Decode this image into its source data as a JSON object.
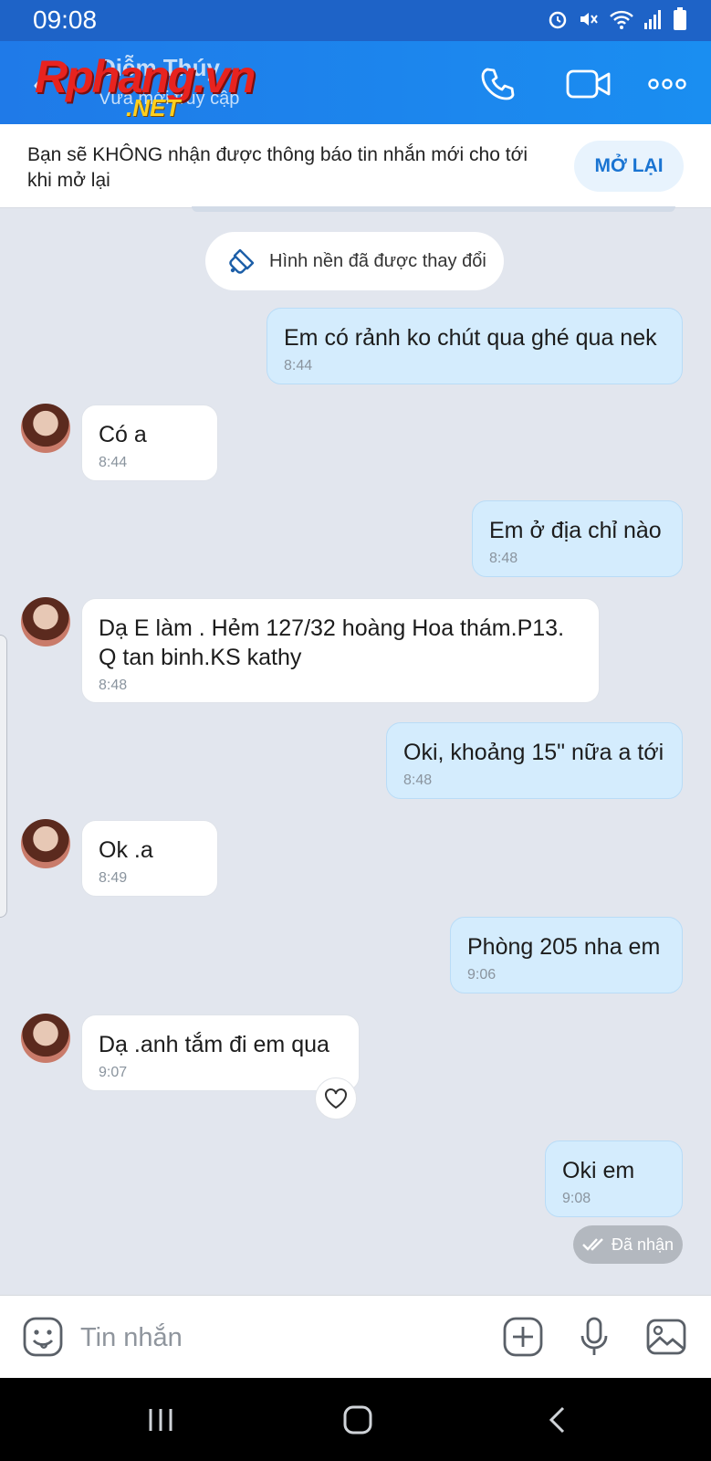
{
  "status_bar": {
    "time": "09:08"
  },
  "header": {
    "contact_name": "Diễm Thúy",
    "contact_status": "Vừa mới truy cập",
    "watermark_main": "Rphang.vn",
    "watermark_sub": ".NET",
    "icons": [
      "back-icon",
      "phone-icon",
      "video-call-icon",
      "more-icon"
    ]
  },
  "notice": {
    "text": "Bạn sẽ KHÔNG nhận được thông báo tin nhắn mới cho tới khi mở lại",
    "button": "MỞ LẠI"
  },
  "system_message": "Hình nền đã được thay đổi",
  "messages": [
    {
      "dir": "out",
      "text": "Em có rảnh ko chút qua ghé qua nek",
      "time": "8:44"
    },
    {
      "dir": "in",
      "text": "Có a",
      "time": "8:44"
    },
    {
      "dir": "out",
      "text": "Em ở địa chỉ nào",
      "time": "8:48"
    },
    {
      "dir": "in",
      "text": "Dạ E làm . Hẻm 127/32 hoàng Hoa thám.P13. Q tan binh.KS kathy",
      "time": "8:48"
    },
    {
      "dir": "out",
      "text": "Oki, khoảng 15\" nữa a tới",
      "time": "8:48"
    },
    {
      "dir": "in",
      "text": "Ok .a",
      "time": "8:49"
    },
    {
      "dir": "out",
      "text": "Phòng 205 nha em",
      "time": "9:06"
    },
    {
      "dir": "in",
      "text": "Dạ .anh tắm đi em qua",
      "time": "9:07"
    },
    {
      "dir": "out",
      "text": "Oki em",
      "time": "9:08"
    }
  ],
  "delivery_status": "Đã nhận",
  "input": {
    "placeholder": "Tin nhắn"
  },
  "colors": {
    "header": "#1f7ae8",
    "outgoing_bubble": "#d4ecfd",
    "chat_background": "#e2e6ee",
    "accent": "#1a74d2"
  }
}
